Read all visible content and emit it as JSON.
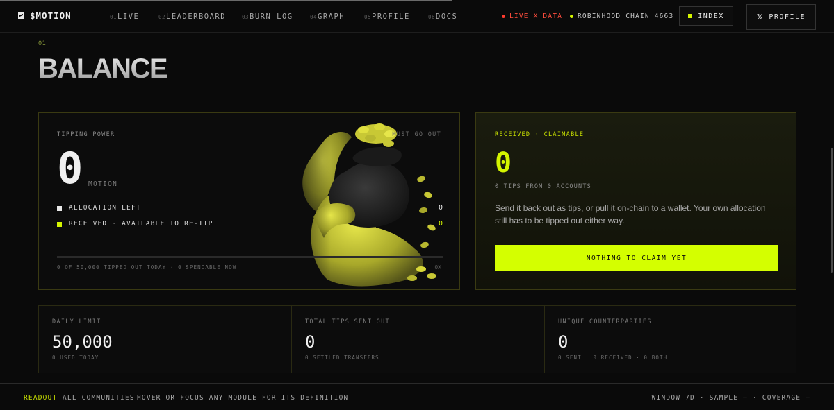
{
  "brand": {
    "name": "$MOTION",
    "logo_icon": "motion-logo-icon"
  },
  "nav": {
    "items": [
      {
        "num": "01",
        "label": "LIVE"
      },
      {
        "num": "02",
        "label": "LEADERBOARD"
      },
      {
        "num": "03",
        "label": "BURN LOG"
      },
      {
        "num": "04",
        "label": "GRAPH"
      },
      {
        "num": "05",
        "label": "PROFILE"
      },
      {
        "num": "06",
        "label": "DOCS"
      }
    ],
    "live_label": "LIVE X DATA",
    "chain_label": "ROBINHOOD CHAIN 4663",
    "index_label": "INDEX",
    "profile_label": "PROFILE",
    "profile_icon": "x-logo-icon"
  },
  "section": {
    "num": "01",
    "title": "BALANCE"
  },
  "tipping": {
    "label": "TIPPING POWER",
    "badge": "MUST GO OUT",
    "value": "0",
    "unit": "MOTION",
    "rows": [
      {
        "label": "ALLOCATION LEFT",
        "value": "0",
        "color": "#e8e8e8"
      },
      {
        "label": "RECEIVED · AVAILABLE TO RE-TIP",
        "value": "0",
        "color": "#d4f500"
      }
    ],
    "progress": 0,
    "footnote": "0 OF 50,000 TIPPED OUT TODAY · 0 SPENDABLE NOW",
    "multiplier": "0X",
    "illustration": "money-bag-mascot"
  },
  "claim": {
    "label": "RECEIVED · CLAIMABLE",
    "value": "0",
    "sub": "0 TIPS FROM 0 ACCOUNTS",
    "description": "Send it back out as tips, or pull it on-chain to a wallet. Your own allocation still has to be tipped out either way.",
    "button_label": "NOTHING TO CLAIM YET"
  },
  "stats": [
    {
      "label": "DAILY LIMIT",
      "value": "50,000",
      "sub": "0 USED TODAY"
    },
    {
      "label": "TOTAL TIPS SENT OUT",
      "value": "0",
      "sub": "0 SETTLED TRANSFERS"
    },
    {
      "label": "UNIQUE COUNTERPARTIES",
      "value": "0",
      "sub": "0 SENT · 0 RECEIVED · 0 BOTH"
    }
  ],
  "footer": {
    "readout": "READOUT",
    "communities": "ALL COMMUNITIES",
    "hint": "HOVER OR FOCUS ANY MODULE FOR ITS DEFINITION",
    "window": "WINDOW 7D · SAMPLE — · COVERAGE —"
  },
  "colors": {
    "accent": "#d4ff00",
    "live": "#ff3b2e",
    "border": "#3a3a12"
  }
}
